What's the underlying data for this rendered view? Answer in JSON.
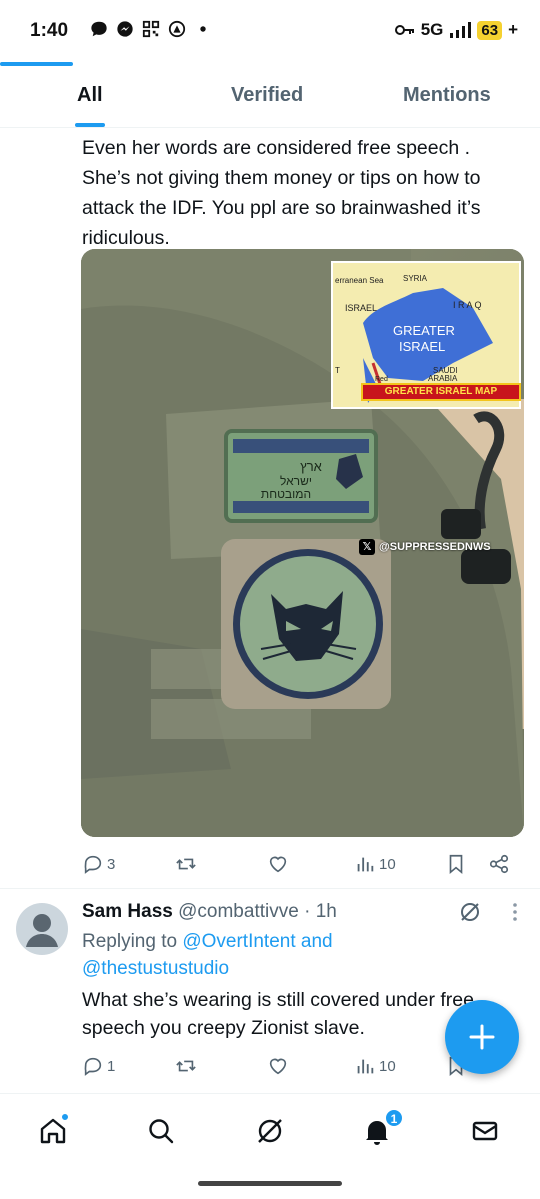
{
  "status_bar": {
    "time": "1:40",
    "network": "5G",
    "battery": "63",
    "battery_suffix": "+"
  },
  "tabs": [
    {
      "label": "All",
      "active": true
    },
    {
      "label": "Verified",
      "active": false
    },
    {
      "label": "Mentions",
      "active": false
    }
  ],
  "post": {
    "text": "Even her words are considered free speech . She’s not giving them money or tips on how to attack the IDF. You ppl are so brainwashed it’s ridiculous.",
    "media": {
      "map_labels": {
        "sea": "erranean Sea",
        "syria": "SYRIA",
        "israel": "ISRAEL",
        "iraq": "I R A Q",
        "greater": "GREATER",
        "greater2": "ISRAEL",
        "saudi": "SAUDI",
        "arabia": "ARABIA",
        "red": "Red",
        "egypt": "T"
      },
      "map_banner": "GREATER ISRAEL MAP",
      "patch_line1": "ארץ",
      "patch_line2": "ישראל",
      "patch_line3": "המובטחת",
      "watermark": "@SUPPRESSEDNWS"
    },
    "actions": {
      "replies": "3",
      "retweets": "",
      "likes": "",
      "views": "10"
    }
  },
  "reply": {
    "name": "Sam Hass",
    "handle": "@combattivve",
    "separator": " · ",
    "time": "1h",
    "replying_prefix": "Replying to ",
    "replying_to_1": "@OvertIntent",
    "replying_and": " and",
    "replying_to_2": "@thestustustudio",
    "text": "What she’s wearing is still covered under free speech you creepy Zionist slave.",
    "actions": {
      "replies": "1",
      "retweets": "",
      "likes": "",
      "views": "10"
    }
  },
  "bottom_nav": {
    "notification_count": "1"
  },
  "colors": {
    "accent": "#1d9bf0",
    "text": "#0f1419",
    "muted": "#536471"
  }
}
